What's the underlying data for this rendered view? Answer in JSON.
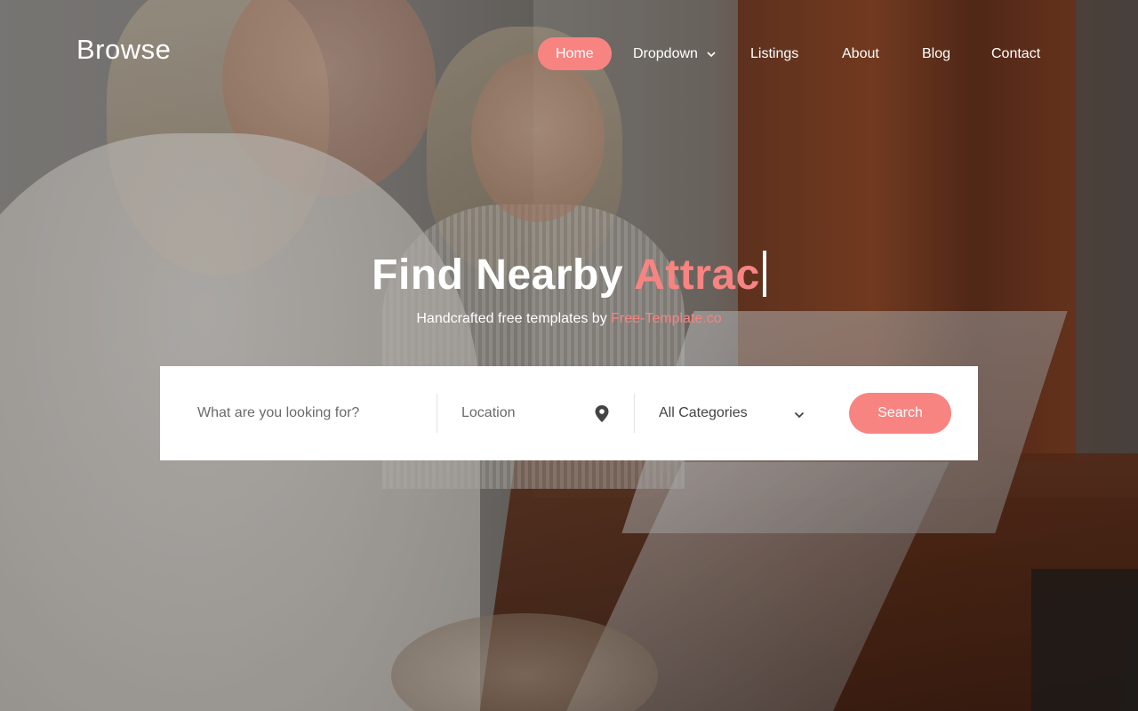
{
  "brand": {
    "logo": "Browse",
    "accent_color": "#f88481"
  },
  "nav": {
    "items": [
      {
        "label": "Home",
        "active": true
      },
      {
        "label": "Dropdown",
        "has_dropdown": true
      },
      {
        "label": "Listings"
      },
      {
        "label": "About"
      },
      {
        "label": "Blog"
      },
      {
        "label": "Contact"
      }
    ]
  },
  "hero": {
    "headline_prefix": "Find Nearby ",
    "headline_typed": "Attrac",
    "subtitle_prefix": "Handcrafted free templates by ",
    "subtitle_link": "Free-Template.co"
  },
  "search": {
    "keyword_placeholder": "What are you looking for?",
    "location_placeholder": "Location",
    "category_selected": "All Categories",
    "button_label": "Search"
  },
  "icons": {
    "location": "map-pin-icon",
    "dropdown": "chevron-down-icon"
  }
}
